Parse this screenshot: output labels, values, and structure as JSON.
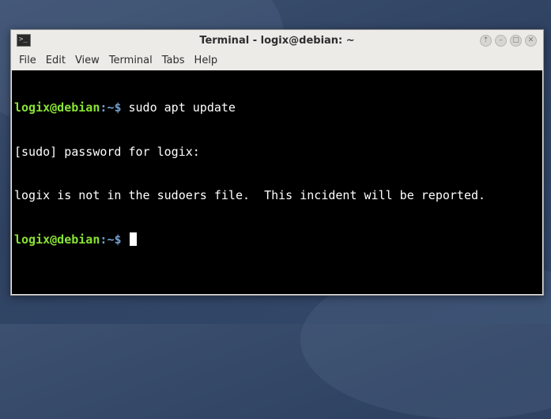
{
  "window": {
    "title": "Terminal - logix@debian: ~",
    "controls": {
      "up": "⇡",
      "minimize": "–",
      "maximize": "□",
      "close": "✕"
    }
  },
  "menubar": {
    "items": [
      "File",
      "Edit",
      "View",
      "Terminal",
      "Tabs",
      "Help"
    ]
  },
  "terminal": {
    "prompt_user": "logix@debian",
    "prompt_sep": ":",
    "prompt_path": "~",
    "prompt_symbol": "$",
    "lines": [
      {
        "type": "command",
        "text": " sudo apt update"
      },
      {
        "type": "output",
        "text": "[sudo] password for logix:"
      },
      {
        "type": "output",
        "text": "logix is not in the sudoers file.  This incident will be reported."
      },
      {
        "type": "prompt",
        "text": " "
      }
    ]
  },
  "colors": {
    "prompt_user": "#8ae234",
    "prompt_path": "#729fcf",
    "terminal_bg": "#000000",
    "terminal_fg": "#ffffff"
  }
}
